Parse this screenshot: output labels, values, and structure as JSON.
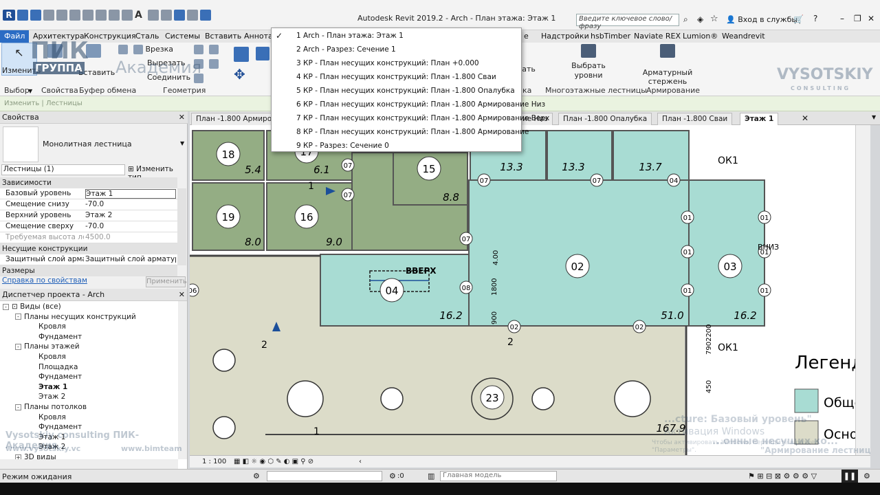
{
  "title_bar": {
    "title": "Autodesk Revit 2019.2 - Arch - План этажа: Этаж 1",
    "search_placeholder": "Введите ключевое слово/фразу",
    "login_label": "Вход в службы"
  },
  "ribbon_tabs": [
    "Файл",
    "Архитектура",
    "Конструкция",
    "Сталь",
    "Системы",
    "Вставить",
    "Аннотат",
    "е",
    "Надстройки",
    "hsbTimber",
    "Naviate REX",
    "Lumion®",
    "Weandrevit"
  ],
  "ribbon": {
    "modify_label": "Изменить",
    "paste_label": "Вставить",
    "cut_label": "Врезка",
    "cut2_label": "Вырезать",
    "join_label": "Соединить",
    "select_levels_label": "Выбрать уровни",
    "select_levels_line2": "",
    "rebar_label": "Арматурный стержень",
    "partial_label": "овать",
    "panel_labels": {
      "select": "Выбор",
      "properties": "Свойства",
      "clipboard": "Буфер обмена",
      "geometry": "Геометрия",
      "ka": "ка",
      "multistory": "Многоэтажные лестницы",
      "reinforcement": "Армирование"
    }
  },
  "watermarks": {
    "pik_logo": "ПИК",
    "group": "ГРУППА",
    "academy": "Академия",
    "vysotskiy": "VYSOTSKIY",
    "consulting": "CONSULTING",
    "bottom_left": "Vysotskiy consulting  ПИК-Академия",
    "bottom_url1": "www.vysotskiy.vc",
    "bottom_url2": "www.bimteam",
    "overlay1": "...cture: Базовый уровень\"",
    "overlay2": "Активация Windows",
    "overlay3": "...онные несущих ко...",
    "overlay4": "Чтобы активировать Windows, перейдите в раздел",
    "overlay5": "\"Армирование лестницы\"",
    "overlay6": "\"Параметры\"."
  },
  "options_bar": {
    "text": "Изменить | Лестницы"
  },
  "properties": {
    "header": "Свойства",
    "type_name": "Монолитная лестница",
    "instance_filter": "Лестницы (1)",
    "edit_type": "Изменить тип",
    "sections": {
      "constraints": "Зависимости",
      "structure": "Несущие конструкции",
      "dimensions": "Размеры"
    },
    "rows": [
      {
        "k": "Базовый уровень",
        "v": "Этаж 1"
      },
      {
        "k": "Смещение снизу",
        "v": "-70.0"
      },
      {
        "k": "Верхний уровень",
        "v": "Этаж 2"
      },
      {
        "k": "Смещение сверху",
        "v": "-70.0"
      },
      {
        "k": "Требуемая высота лест...",
        "v": "4500.0"
      }
    ],
    "structure_row": {
      "k": "Защитный слой армату...",
      "v": "Защитный слой арматур..."
    },
    "help_link": "Справка по свойствам",
    "apply": "Применить"
  },
  "project_browser": {
    "header": "Диспетчер проекта - Arch",
    "nodes": [
      {
        "label": "Виды (все)",
        "level": 0,
        "exp": "-"
      },
      {
        "label": "Планы несущих конструкций",
        "level": 1,
        "exp": "-"
      },
      {
        "label": "Кровля",
        "level": 2
      },
      {
        "label": "Фундамент",
        "level": 2
      },
      {
        "label": "Планы этажей",
        "level": 1,
        "exp": "-"
      },
      {
        "label": "Кровля",
        "level": 2
      },
      {
        "label": "Площадка",
        "level": 2
      },
      {
        "label": "Фундамент",
        "level": 2
      },
      {
        "label": "Этаж 1",
        "level": 2,
        "bold": true
      },
      {
        "label": "Этаж 2",
        "level": 2
      },
      {
        "label": "Планы потолков",
        "level": 1,
        "exp": "-"
      },
      {
        "label": "Кровля",
        "level": 2
      },
      {
        "label": "Фундамент",
        "level": 2
      },
      {
        "label": "Этаж 1",
        "level": 2
      },
      {
        "label": "Этаж 2",
        "level": 2
      },
      {
        "label": "3D виды",
        "level": 1,
        "exp": "+"
      }
    ]
  },
  "view_tabs": [
    {
      "label": "План -1.800 Армиров"
    },
    {
      "label": "ние Низ"
    },
    {
      "label": "План -1.800 Опалубка"
    },
    {
      "label": "План -1.800 Сваи"
    },
    {
      "label": "Этаж 1",
      "active": true
    }
  ],
  "views_menu": [
    {
      "label": "1 Arch - План этажа: Этаж 1",
      "checked": true
    },
    {
      "label": "2 Arch - Разрез: Сечение 1"
    },
    {
      "label": "3 КР - План несущих конструкций: План +0.000"
    },
    {
      "label": "4 КР - План несущих конструкций: План -1.800 Сваи"
    },
    {
      "label": "5 КР - План несущих конструкций: План -1.800 Опалубка"
    },
    {
      "label": "6 КР - План несущих конструкций: План -1.800 Армирование Низ"
    },
    {
      "label": "7 КР - План несущих конструкций: План -1.800 Армирование Верх"
    },
    {
      "label": "8 КР - План несущих конструкций: План -1.800 Армирование"
    },
    {
      "label": "9 КР - Разрез: Сечение 0"
    }
  ],
  "plan": {
    "rooms": [
      {
        "num": "18",
        "area": "5.4"
      },
      {
        "num": "17",
        "area": "6.1"
      },
      {
        "num": "15",
        "area": "8.8"
      },
      {
        "num": "19",
        "area": "8.0"
      },
      {
        "num": "16",
        "area": "9.0"
      },
      {
        "num": "02",
        "area": "51.0"
      },
      {
        "num": "03",
        "area": "16.2"
      },
      {
        "num": "04",
        "area": "16.2"
      },
      {
        "num": "23",
        "area": "167.9"
      }
    ],
    "small_areas": [
      "13.3",
      "13.3",
      "13.7"
    ],
    "tags": [
      "07",
      "07",
      "07",
      "07",
      "04",
      "01",
      "01",
      "01",
      "01",
      "01",
      "01",
      "08",
      "02",
      "02",
      "06",
      "07"
    ],
    "labels": {
      "up": "ВВЕРХ",
      "down": "ВНИЗ",
      "ok1": "ОК1",
      "legend_title": "Легенда",
      "legend_item1": "Общее",
      "legend_item2": "Основн",
      "section1": "1",
      "section2": "2",
      "dim1": "4.00",
      "dim2": "1800",
      "dim3": "900",
      "dim4": "7902200",
      "dim5": "450"
    }
  },
  "view_status": {
    "scale": "1 : 100"
  },
  "status_bar": {
    "status": "Режим ожидания",
    "zero": ":0",
    "model": "Главная модель"
  },
  "colors": {
    "accent": "#2b6cc4",
    "room_green": "#93ac82",
    "room_teal": "#a6dbd3",
    "room_beige": "#d9dbc8"
  }
}
